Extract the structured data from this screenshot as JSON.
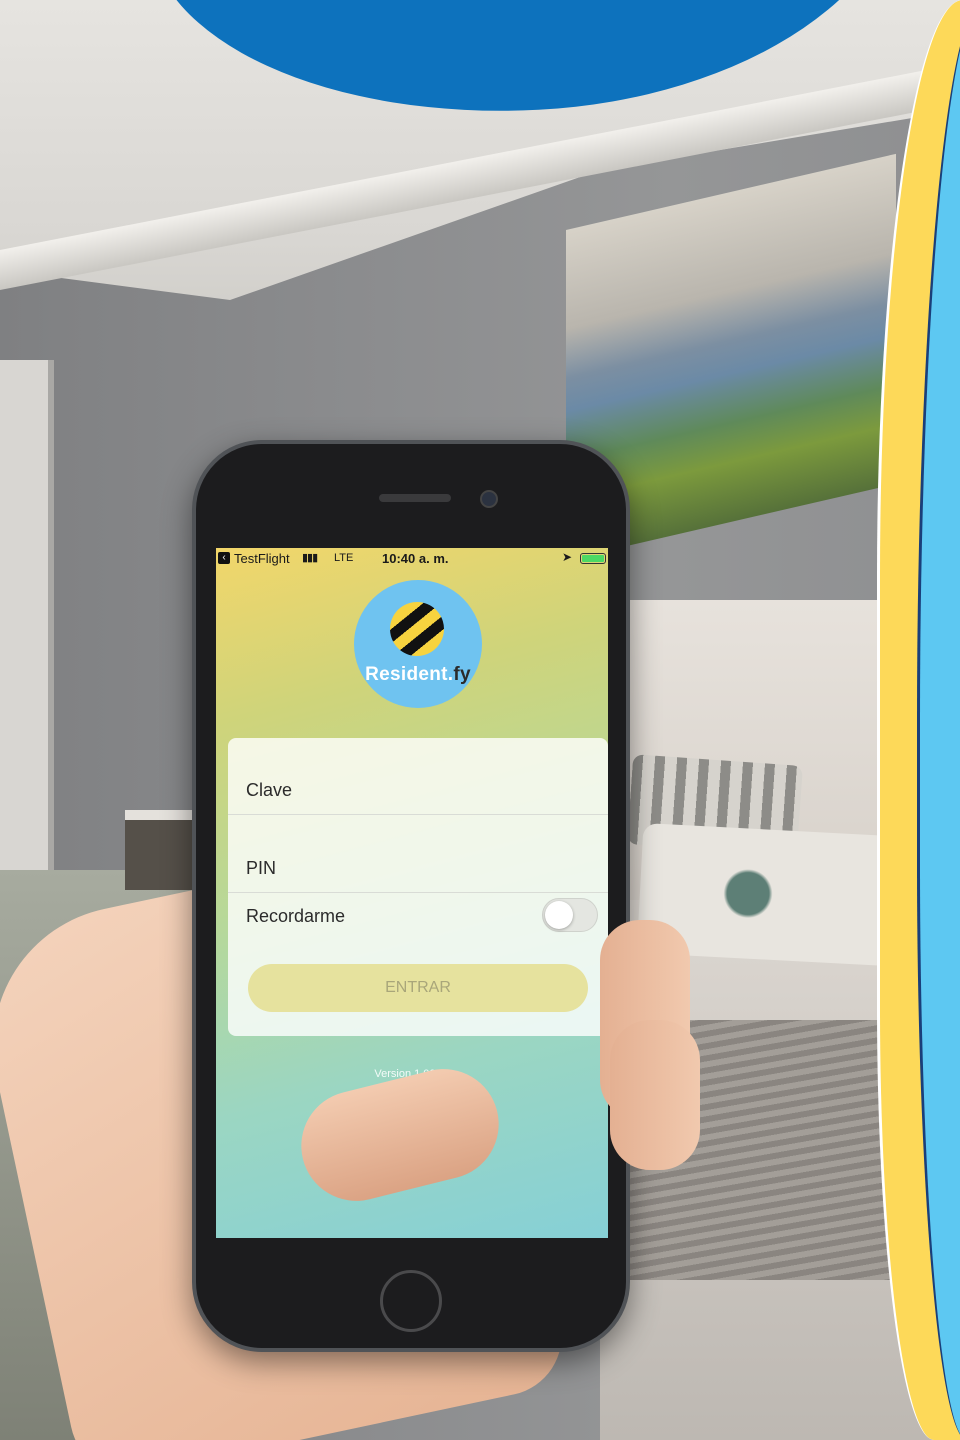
{
  "status_bar": {
    "back_app": "TestFlight",
    "signal": "▮▮▮",
    "network": "LTE",
    "time": "10:40 a. m.",
    "location_icon": "location-arrow-icon",
    "battery_color": "#4cd964"
  },
  "logo": {
    "text_main": "Resident.",
    "text_suffix": "fy",
    "circle_color": "#6fc3f0"
  },
  "form": {
    "clave_label": "Clave",
    "pin_label": "PIN",
    "remember_label": "Recordarme",
    "remember_on": false,
    "submit_label": "ENTRAR"
  },
  "footer": {
    "version": "Version 1.00 ID"
  },
  "decor": {
    "blue_wave": "#0d72bd",
    "yellow_band": "#fdd959",
    "cyan_band": "#5dc8f2"
  }
}
